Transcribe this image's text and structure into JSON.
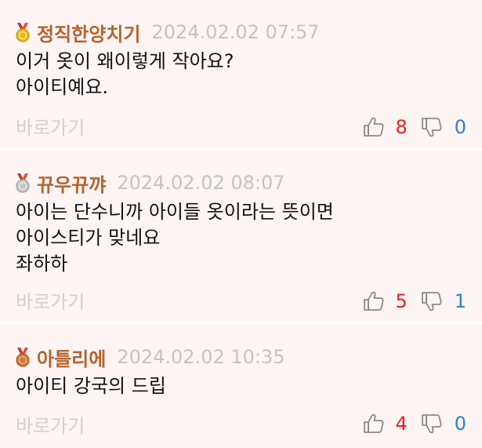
{
  "colors": {
    "nickname": "#b5632d",
    "timestamp": "#c6c2c2",
    "likes": "#e4241b",
    "dislikes": "#2f7fd3",
    "background": "#fdf5f4"
  },
  "comments": [
    {
      "medal": "gold-medal-icon",
      "nickname": "정직한양치기",
      "timestamp": "2024.02.02 07:57",
      "text": "이거 옷이 왜이렇게 작아요?\n아이티예요.",
      "shortcut": "바로가기",
      "likes": "8",
      "dislikes": "0"
    },
    {
      "medal": "silver-medal-icon",
      "nickname": "뀨우뀨꺄",
      "timestamp": "2024.02.02 08:07",
      "text": "아이는 단수니까 아이들 옷이라는 뜻이면\n아이스티가 맞네요\n좌하하",
      "shortcut": "바로가기",
      "likes": "5",
      "dislikes": "1"
    },
    {
      "medal": "bronze-medal-icon",
      "nickname": "아틀리에",
      "timestamp": "2024.02.02 10:35",
      "text": "아이티 강국의 드립",
      "shortcut": "바로가기",
      "likes": "4",
      "dislikes": "0"
    }
  ]
}
